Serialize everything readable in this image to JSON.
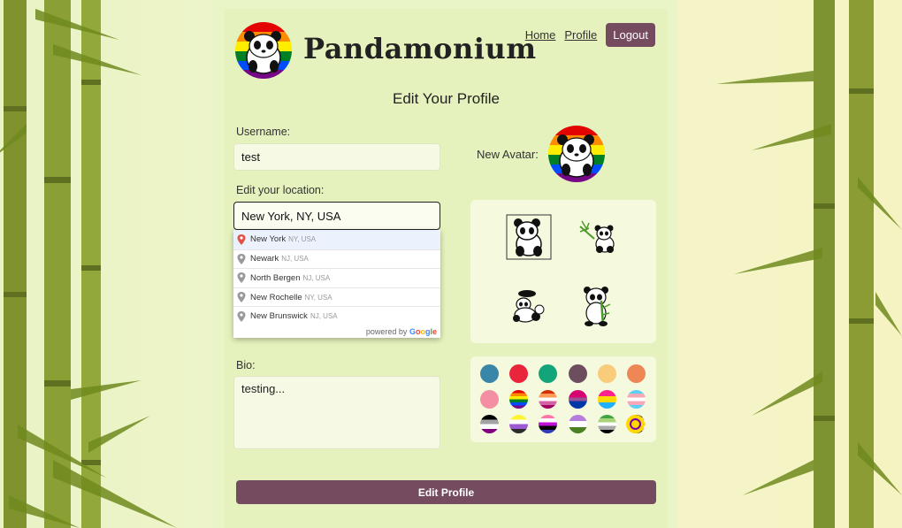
{
  "brand": {
    "name": "Pandamonium"
  },
  "nav": {
    "home": "Home",
    "profile": "Profile",
    "logout": "Logout"
  },
  "form": {
    "title": "Edit Your Profile",
    "username_label": "Username:",
    "username_value": "test",
    "location_label": "Edit your location:",
    "location_value": "New York, NY, USA",
    "bio_label": "Bio:",
    "bio_value": "testing...",
    "avatar_label": "New Avatar:",
    "submit_label": "Edit Profile"
  },
  "suggestions": [
    {
      "main": "New York",
      "secondary": "NY, USA"
    },
    {
      "main": "Newark",
      "secondary": "NJ, USA"
    },
    {
      "main": "North Bergen",
      "secondary": "NJ, USA"
    },
    {
      "main": "New Rochelle",
      "secondary": "NY, USA"
    },
    {
      "main": "New Brunswick",
      "secondary": "NJ, USA"
    }
  ],
  "powered_by": {
    "prefix": "powered by",
    "brand": "Google"
  },
  "avatars": [
    "panda-sitting-icon",
    "panda-bamboo-icon",
    "panda-hat-icon",
    "panda-standing-icon"
  ],
  "colors": {
    "accent": "#754b5f",
    "swatches_solid": [
      "#3a86a8",
      "#e8253a",
      "#13a57a",
      "#6d4e5e",
      "#f9cc7b",
      "#ee8656",
      "#f48ea2"
    ],
    "swatches_flags": [
      "rainbow-flag",
      "lesbian-flag",
      "bisexual-flag",
      "pansexual-flag",
      "transgender-flag",
      "asexual-flag",
      "nonbinary-flag",
      "genderfluid-flag",
      "genderqueer-flag",
      "aromantic-flag",
      "agender-flag",
      "intersex-flag"
    ]
  }
}
